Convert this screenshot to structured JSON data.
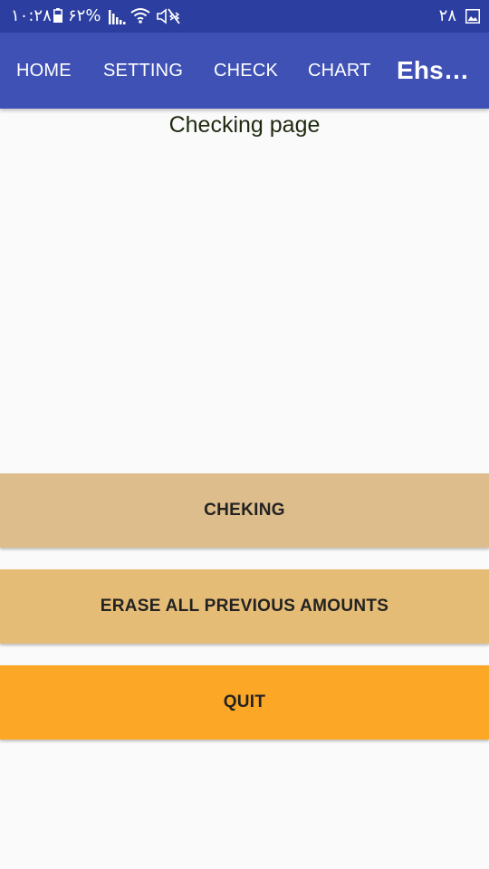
{
  "status_bar": {
    "time": "۱۰:۲۸",
    "battery": "۶۲%",
    "date": "۲۸",
    "icons": [
      "battery-icon",
      "signal-icon",
      "wifi-icon",
      "mute-icon",
      "gallery-icon"
    ]
  },
  "appbar": {
    "tabs": [
      {
        "label": "HOME"
      },
      {
        "label": "SETTING"
      },
      {
        "label": "CHECK"
      },
      {
        "label": "CHART"
      }
    ],
    "title": "Ehs…"
  },
  "page": {
    "heading": "Checking page"
  },
  "buttons": {
    "checking": "CHEKING",
    "erase": "ERASE ALL PREVIOUS AMOUNTS",
    "quit": "QUIT"
  },
  "colors": {
    "status_bar": "#2c3fa0",
    "appbar": "#3f51b5",
    "background": "#fafafa",
    "checking_button": "#ddbd8b",
    "erase_button": "#e5bc76",
    "quit_button": "#fca726"
  }
}
